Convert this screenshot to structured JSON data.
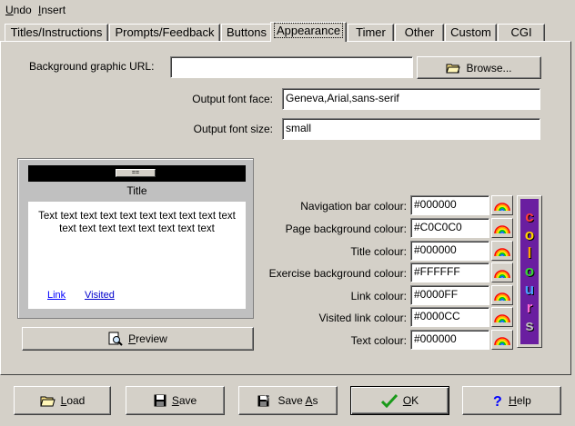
{
  "menu": [
    {
      "label": "Undo",
      "key": "U",
      "rest": "ndo"
    },
    {
      "label": "Insert",
      "key": "I",
      "rest": "nsert"
    }
  ],
  "tabs": [
    {
      "label": "Titles/Instructions",
      "active": false
    },
    {
      "label": "Prompts/Feedback",
      "active": false
    },
    {
      "label": "Buttons",
      "active": false
    },
    {
      "label": "Appearance",
      "active": true
    },
    {
      "label": "Timer",
      "active": false
    },
    {
      "label": "Other",
      "active": false
    },
    {
      "label": "Custom",
      "active": false
    },
    {
      "label": "CGI",
      "active": false
    }
  ],
  "appearance": {
    "bg_graphic_label": "Background graphic URL:",
    "bg_graphic_value": "",
    "browse_label": "Browse...",
    "font_face_label": "Output font face:",
    "font_face_value": "Geneva,Arial,sans-serif",
    "font_size_label": "Output font size:",
    "font_size_value": "small"
  },
  "preview": {
    "nav_button_text": "==",
    "title": "Title",
    "body_text": "Text text text text text text text text text text text text text text text text text text",
    "link": "Link",
    "visited": "Visited",
    "preview_button_key": "P",
    "preview_button_rest": "review",
    "colors": {
      "nav_bar": "#000000",
      "page_bg": "#C0C0C0",
      "title": "#000000",
      "exercise_bg": "#FFFFFF",
      "link": "#0000FF",
      "visited": "#0000CC",
      "text": "#000000"
    }
  },
  "colour_settings": [
    {
      "label": "Navigation bar colour:",
      "value": "#000000"
    },
    {
      "label": "Page background colour:",
      "value": "#C0C0C0"
    },
    {
      "label": "Title colour:",
      "value": "#000000"
    },
    {
      "label": "Exercise background colour:",
      "value": "#FFFFFF"
    },
    {
      "label": "Link colour:",
      "value": "#0000FF"
    },
    {
      "label": "Visited link colour:",
      "value": "#0000CC"
    },
    {
      "label": "Text colour:",
      "value": "#000000"
    }
  ],
  "colours_banner": {
    "letters": [
      "c",
      "o",
      "l",
      "o",
      "u",
      "r",
      "s"
    ],
    "letter_colors": [
      "#ff3b3b",
      "#ffd200",
      "#ffa500",
      "#3bd23b",
      "#4aa0ff",
      "#ff6ad5",
      "#c0c0c0"
    ]
  },
  "bottom_buttons": {
    "load": {
      "key": "L",
      "rest": "oad"
    },
    "save": {
      "key": "S",
      "rest": "ave"
    },
    "save_as_pre": "Save ",
    "save_as_key": "A",
    "save_as_rest": "s",
    "ok": {
      "key": "O",
      "rest": "K"
    },
    "help": {
      "key": "H",
      "rest": "elp"
    }
  }
}
